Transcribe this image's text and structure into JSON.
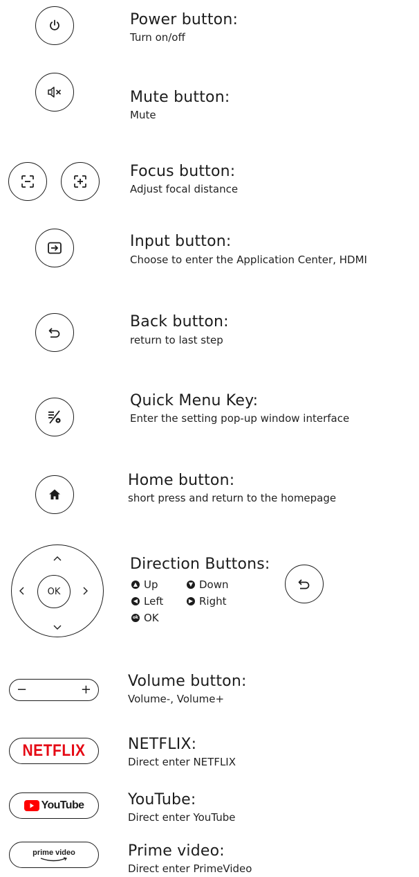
{
  "items": [
    {
      "title": "Power button:",
      "desc": "Turn on/off"
    },
    {
      "title": "Mute button:",
      "desc": "Mute"
    },
    {
      "title": "Focus button:",
      "desc": "Adjust focal distance"
    },
    {
      "title": "Input button:",
      "desc": "Choose to enter the Application Center, HDMI"
    },
    {
      "title": "Back button:",
      "desc": "return to last step"
    },
    {
      "title": "Quick Menu Key:",
      "desc": "Enter the setting pop-up window interface"
    },
    {
      "title": "Home button:",
      "desc": "short press and return to the homepage"
    },
    {
      "title": "Direction Buttons:",
      "desc": ""
    },
    {
      "title": "Volume button:",
      "desc": "Volume-, Volume+"
    },
    {
      "title": "NETFLIX:",
      "desc": "Direct enter NETFLIX"
    },
    {
      "title": "YouTube:",
      "desc": "Direct enter YouTube"
    },
    {
      "title": "Prime video:",
      "desc": "Direct enter PrimeVideo"
    }
  ],
  "direction": {
    "up": "Up",
    "down": "Down",
    "left": "Left",
    "right": "Right",
    "ok": "OK",
    "dpad_ok": "OK"
  },
  "volume": {
    "minus": "−",
    "plus": "+"
  },
  "logos": {
    "netflix": "NETFLIX",
    "youtube": "YouTube",
    "prime": "prime video"
  },
  "icons": {
    "power": "power-icon",
    "mute": "mute-icon",
    "focus_minus": "focus-minus-icon",
    "focus_plus": "focus-plus-icon",
    "input": "input-icon",
    "back": "back-icon",
    "quick_menu": "quick-menu-icon",
    "home": "home-icon"
  },
  "colors": {
    "netflix_red": "#e50914",
    "youtube_red": "#ff0000",
    "ink": "#1c1c1c"
  }
}
